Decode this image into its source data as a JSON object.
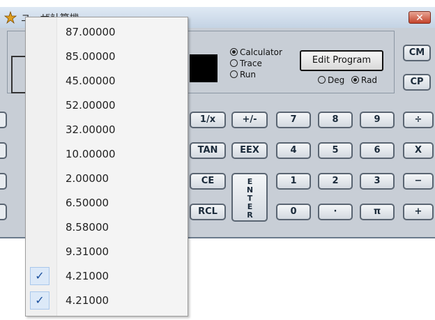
{
  "window": {
    "title": "ユーザ計算機",
    "close_label": "✕"
  },
  "panel": {
    "mode_options": [
      "Calculator",
      "Trace",
      "Run"
    ],
    "selected_mode": "Calculator",
    "edit_program_label": "Edit Program",
    "angle_options": [
      "Deg",
      "Rad"
    ],
    "selected_angle": "Rad",
    "memory_buttons": [
      "CM",
      "CP"
    ]
  },
  "keypad": {
    "row1": [
      "1/x",
      "+/-",
      "7",
      "8",
      "9",
      "÷"
    ],
    "row2": [
      "TAN",
      "EEX",
      "4",
      "5",
      "6",
      "X"
    ],
    "row3": [
      "CE",
      "1",
      "2",
      "3",
      "−"
    ],
    "row4": [
      "RCL",
      "0",
      "·",
      "π",
      "+"
    ],
    "enter_label": "ENTER"
  },
  "popup": {
    "items": [
      {
        "label": "87.00000",
        "checked": false
      },
      {
        "label": "85.00000",
        "checked": false
      },
      {
        "label": "45.00000",
        "checked": false
      },
      {
        "label": "52.00000",
        "checked": false
      },
      {
        "label": "32.00000",
        "checked": false
      },
      {
        "label": "10.00000",
        "checked": false
      },
      {
        "label": "2.00000",
        "checked": false
      },
      {
        "label": "6.50000",
        "checked": false
      },
      {
        "label": "8.58000",
        "checked": false
      },
      {
        "label": "9.31000",
        "checked": false
      },
      {
        "label": "4.21000",
        "checked": true
      },
      {
        "label": "4.21000",
        "checked": true
      }
    ],
    "check_glyph": "✓"
  }
}
